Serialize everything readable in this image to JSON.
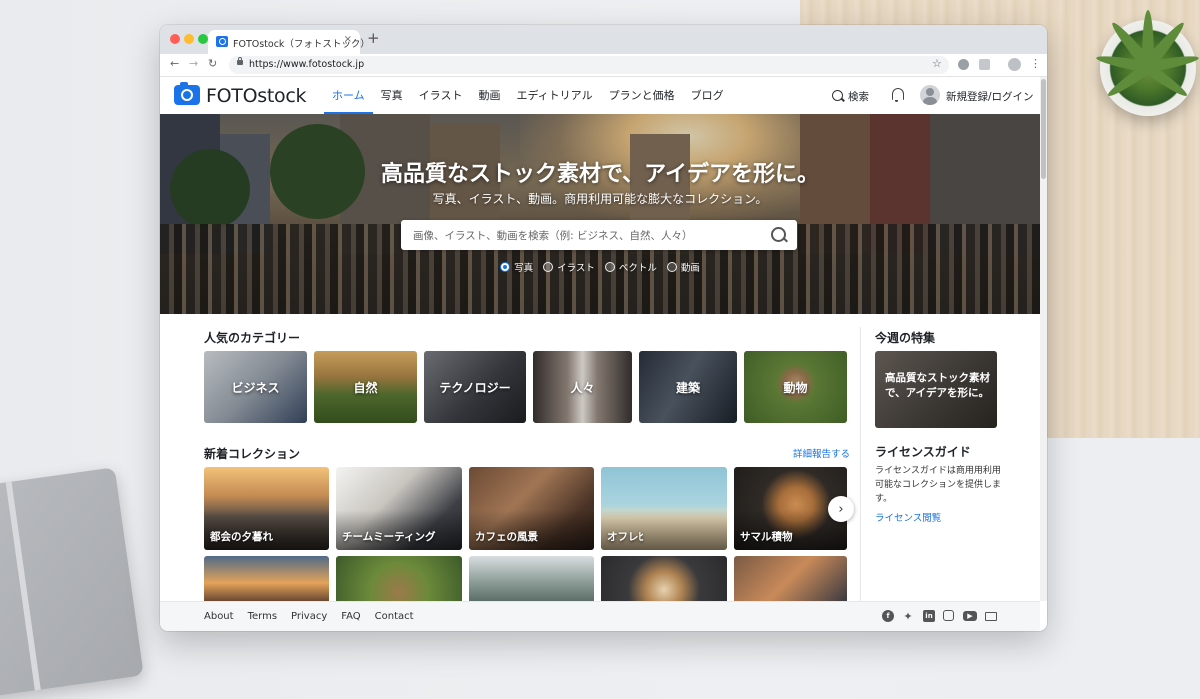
{
  "browser": {
    "tab_title": "FOTOstock（フォトストック）",
    "tab_close": "×",
    "new_tab": "+",
    "url": "https://www.fotostock.jp"
  },
  "site": {
    "logo": "FOTOstock",
    "nav": [
      "ホーム",
      "写真",
      "イラスト",
      "動画",
      "エディトリアル",
      "プランと価格",
      "ブログ"
    ],
    "search_label": "検索",
    "login_label": "新規登録/ログイン"
  },
  "hero": {
    "title": "高品質なストック素材で、アイデアを形に。",
    "subtitle": "写真、イラスト、動画。商用利用可能な膨大なコレクション。",
    "search_placeholder": "画像、イラスト、動画を検索（例: ビジネス、自然、人々）",
    "media_types": [
      "写真",
      "イラスト",
      "ベクトル",
      "動画"
    ],
    "selected_media_type": "写真"
  },
  "categories": {
    "title": "人気のカテゴリー",
    "items": [
      "ビジネス",
      "自然",
      "テクノロジー",
      "人々",
      "建築",
      "動物"
    ]
  },
  "collections": {
    "title": "新着コレクション",
    "more_link": "詳細報告する",
    "items": [
      "都会の夕暮れ",
      "チームミーティング",
      "カフェの風景",
      "オフレﾋ",
      "サマル積物"
    ],
    "next": "›"
  },
  "sidebar": {
    "feature_title": "今週の特集",
    "feature_card_text": "高品質なストック素材で、アイデアを形に。",
    "guide_title": "ライセンスガイド",
    "guide_text": "ライセンスガイドは商用用利用可能なコレクションを提供します。",
    "guide_link": "ライセンス閲覧"
  },
  "footer": {
    "links": [
      "About",
      "Terms",
      "Privacy",
      "FAQ",
      "Contact"
    ],
    "social_icons": [
      "facebook-icon",
      "twitter-icon",
      "linkedin-icon",
      "instagram-icon",
      "youtube-icon",
      "mail-icon"
    ]
  },
  "colors": {
    "accent": "#1a73e8",
    "text": "#1f2328"
  }
}
